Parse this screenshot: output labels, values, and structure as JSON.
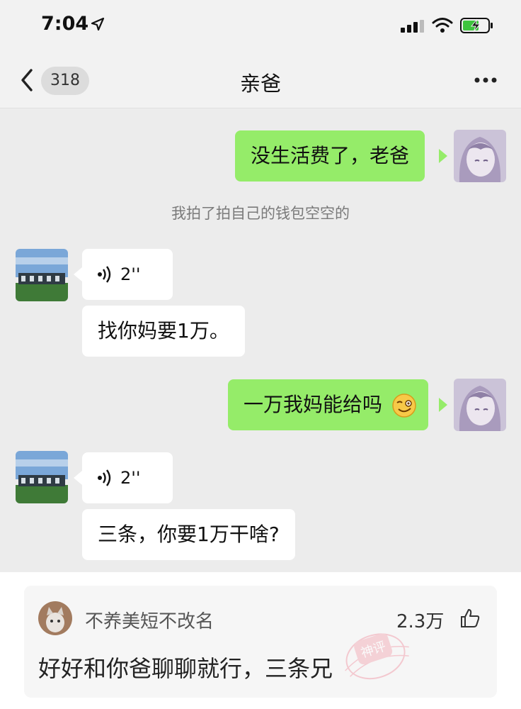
{
  "statusbar": {
    "time": "7:04"
  },
  "header": {
    "unread_count": "318",
    "title": "亲爸"
  },
  "messages": [
    {
      "text": "没生活费了，老爸"
    },
    {
      "text": "我拍了拍自己的钱包空空的"
    },
    {
      "duration": "2''"
    },
    {
      "text": "找你妈要1万。"
    },
    {
      "text": "一万我妈能给吗"
    },
    {
      "duration": "2''"
    },
    {
      "text": "三条，你要1万干啥?"
    }
  ],
  "comment": {
    "username": "不养美短不改名",
    "likes": "2.3万",
    "text": "好好和你爸聊聊就行，三条兄",
    "stamp_text": "神评"
  },
  "colors": {
    "sent_bubble": "#95ec69",
    "received_bubble": "#ffffff",
    "chat_bg": "#ececec"
  }
}
